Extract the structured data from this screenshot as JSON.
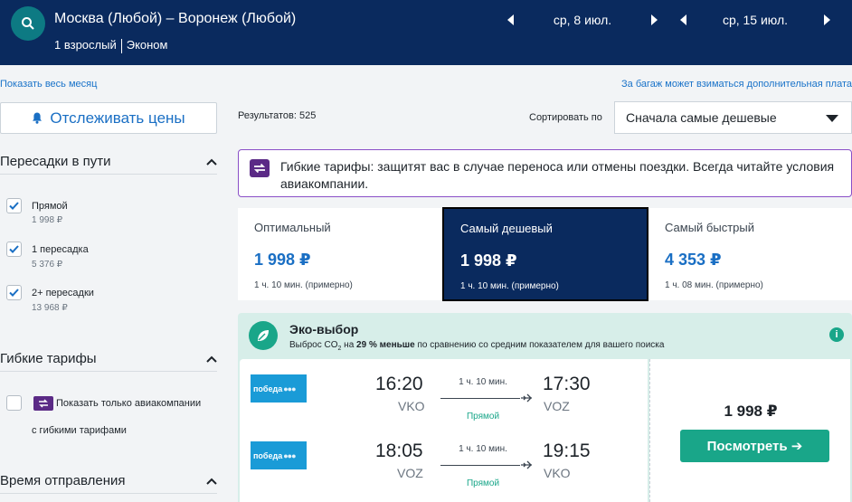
{
  "header": {
    "route": "Москва (Любой) – Воронеж (Любой)",
    "passengers": "1 взрослый",
    "cabin": "Эконом",
    "date_there": "ср, 8 июл.",
    "date_back": "ср, 15 июл."
  },
  "links": {
    "show_month": "Показать весь месяц",
    "baggage": "За багаж может взиматься дополнительная плата"
  },
  "track_button": "Отслеживать цены",
  "filters": {
    "stops": {
      "title": "Пересадки в пути",
      "options": [
        {
          "label": "Прямой",
          "price": "1 998 ₽",
          "checked": true
        },
        {
          "label": "1 пересадка",
          "price": "5 376 ₽",
          "checked": true
        },
        {
          "label": "2+ пересадки",
          "price": "13 968 ₽",
          "checked": true
        }
      ]
    },
    "flex": {
      "title": "Гибкие тарифы",
      "option_line1": "Показать только авиакомпании",
      "option_line2": "с гибкими тарифами",
      "checked": false
    },
    "departure": {
      "title": "Время отправления"
    }
  },
  "results": {
    "count_text": "Результатов: 525",
    "sort_label": "Сортировать по",
    "sort_value": "Сначала самые дешевые"
  },
  "banner": {
    "text": "Гибкие тарифы: защитят вас в случае переноса или отмены поездки. Всегда читайте условия авиакомпании."
  },
  "tabs": [
    {
      "title": "Оптимальный",
      "price": "1 998 ₽",
      "duration": "1 ч. 10 мин. (примерно)",
      "active": false
    },
    {
      "title": "Самый дешевый",
      "price": "1 998 ₽",
      "duration": "1 ч. 10 мин. (примерно)",
      "active": true
    },
    {
      "title": "Самый быстрый",
      "price": "4 353 ₽",
      "duration": "1 ч. 08 мин. (примерно)",
      "active": false
    }
  ],
  "eco": {
    "title": "Эко-выбор",
    "sub_prefix": "Выброс CO",
    "sub_sub": "2",
    "sub_mid": " на ",
    "sub_bold": "29 % меньше",
    "sub_suffix": " по сравнению со средним показателем для вашего поиска",
    "info": "i"
  },
  "flights": [
    {
      "airline": "победа",
      "dep_time": "16:20",
      "dep_ap": "VKO",
      "duration": "1 ч. 10 мин.",
      "type": "Прямой",
      "arr_time": "17:30",
      "arr_ap": "VOZ"
    },
    {
      "airline": "победа",
      "dep_time": "18:05",
      "dep_ap": "VOZ",
      "duration": "1 ч. 10 мин.",
      "type": "Прямой",
      "arr_time": "19:15",
      "arr_ap": "VKO"
    }
  ],
  "offer": {
    "price": "1 998 ₽",
    "button": "Посмотреть ➔"
  },
  "colors": {
    "header_bg": "#0a2a5e",
    "accent_teal": "#19a689",
    "link_blue": "#1a73c9",
    "flex_purple": "#8a4fc7",
    "eco_bg": "#d7eee9",
    "pobeda_blue": "#1a9bd7"
  }
}
